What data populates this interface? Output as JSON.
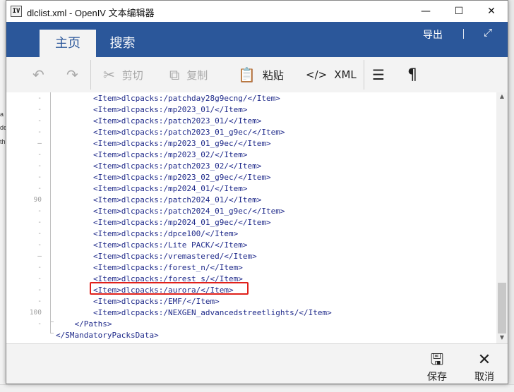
{
  "background": {
    "left_fragments": [
      "a",
      "de",
      "th"
    ]
  },
  "window": {
    "title": "dlclist.xml - OpenIV 文本编辑器",
    "app_icon_text": "IV",
    "controls": {
      "minimize": "—",
      "maximize": "☐",
      "close": "✕"
    }
  },
  "ribbon": {
    "tabs": [
      {
        "label": "主页"
      },
      {
        "label": "搜索"
      }
    ],
    "export_label": "导出",
    "fullscreen_icon": "⤢",
    "accent_color": "#2b579a"
  },
  "toolbar": {
    "undo_icon": "↶",
    "redo_icon": "↷",
    "cut": {
      "icon": "✂",
      "label": "剪切"
    },
    "copy": {
      "icon": "⧉",
      "label": "复制"
    },
    "paste": {
      "icon": "📋",
      "label": "粘贴"
    },
    "xml": {
      "icon": "</>",
      "label": "XML"
    },
    "format_icon": "☰",
    "pilcrow_icon": "¶"
  },
  "editor": {
    "lines": [
      {
        "num": "-",
        "text": "        <Item>dlcpacks:/patchday28g9ecng/</Item>"
      },
      {
        "num": "-",
        "text": "        <Item>dlcpacks:/mp2023_01/</Item>"
      },
      {
        "num": "-",
        "text": "        <Item>dlcpacks:/patch2023_01/</Item>"
      },
      {
        "num": "-",
        "text": "        <Item>dlcpacks:/patch2023_01_g9ec/</Item>"
      },
      {
        "num": "–",
        "text": "        <Item>dlcpacks:/mp2023_01_g9ec/</Item>"
      },
      {
        "num": "-",
        "text": "        <Item>dlcpacks:/mp2023_02/</Item>"
      },
      {
        "num": "-",
        "text": "        <Item>dlcpacks:/patch2023_02/</Item>"
      },
      {
        "num": "-",
        "text": "        <Item>dlcpacks:/mp2023_02_g9ec/</Item>"
      },
      {
        "num": "-",
        "text": "        <Item>dlcpacks:/mp2024_01/</Item>"
      },
      {
        "num": "90",
        "text": "        <Item>dlcpacks:/patch2024_01/</Item>"
      },
      {
        "num": "-",
        "text": "        <Item>dlcpacks:/patch2024_01_g9ec/</Item>"
      },
      {
        "num": "-",
        "text": "        <Item>dlcpacks:/mp2024_01_g9ec/</Item>"
      },
      {
        "num": "-",
        "text": "        <Item>dlcpacks:/dpce100/</Item>"
      },
      {
        "num": "-",
        "text": "        <Item>dlcpacks:/Lite PACK/</Item>"
      },
      {
        "num": "–",
        "text": "        <Item>dlcpacks:/vremastered/</Item>"
      },
      {
        "num": "-",
        "text": "        <Item>dlcpacks:/forest_n/</Item>"
      },
      {
        "num": "-",
        "text": "        <Item>dlcpacks:/forest_s/</Item>"
      },
      {
        "num": "-",
        "text": "        <Item>dlcpacks:/aurora/</Item>"
      },
      {
        "num": "-",
        "text": "        <Item>dlcpacks:/EMF/</Item>"
      },
      {
        "num": "100",
        "text": "        <Item>dlcpacks:/NEXGEN_advancedstreetlights/</Item>"
      },
      {
        "num": "-",
        "text": "    </Paths>"
      },
      {
        "num": "",
        "text": "</SMandatoryPacksData>"
      }
    ],
    "highlight_color": "#e0201a"
  },
  "footer": {
    "save": {
      "icon": "🖫",
      "label": "保存"
    },
    "cancel": {
      "icon": "✕",
      "label": "取消"
    }
  }
}
